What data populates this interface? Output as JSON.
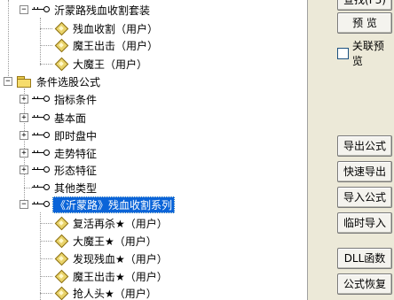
{
  "tree": {
    "r1": "沂蒙路残血收割套装",
    "r2": "残血收割（用户）",
    "r3": "魔王出击（用户）",
    "r4": "大魔王（用户）",
    "r5": "条件选股公式",
    "r6": "指标条件",
    "r7": "基本面",
    "r8": "即时盘中",
    "r9": "走势特征",
    "r10": "形态特征",
    "r11": "其他类型",
    "r12": "《沂蒙路》残血收割系列",
    "r13": "复活再杀★（用户）",
    "r14": "大魔王★（用户）",
    "r15": "发现残血★（用户）",
    "r16": "魔王出击★（用户）",
    "r17": "抢人头★（用户）",
    "expand_plus": "+",
    "expand_minus": "−"
  },
  "side": {
    "find": "查找(F3)",
    "preview": "预 览",
    "link_preview": "关联预览",
    "export": "导出公式",
    "quick_export": "快速导出",
    "import": "导入公式",
    "temp_import": "临时导入",
    "dll": "DLL函数",
    "restore": "公式恢复"
  }
}
